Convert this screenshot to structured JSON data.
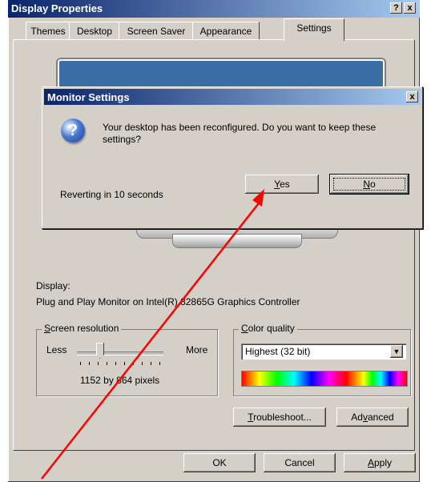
{
  "window": {
    "title": "Display Properties",
    "help_button": "?",
    "close_button": "x"
  },
  "tabs": [
    {
      "label": "Themes"
    },
    {
      "label": "Desktop"
    },
    {
      "label": "Screen Saver"
    },
    {
      "label": "Appearance"
    },
    {
      "label": "Settings"
    }
  ],
  "active_tab": "Settings",
  "dialog": {
    "title": "Monitor Settings",
    "close_button": "x",
    "message": "Your desktop has been reconfigured.  Do you want to keep these settings?",
    "countdown": "Reverting in 10 seconds",
    "yes_label": "Yes",
    "no_label": "No"
  },
  "display": {
    "label": "Display:",
    "value": "Plug and Play Monitor on Intel(R) 82865G Graphics Controller"
  },
  "resolution": {
    "group_label": "Screen resolution",
    "less": "Less",
    "more": "More",
    "value_text": "1152 by 864 pixels"
  },
  "color_quality": {
    "group_label": "Color quality",
    "selected": "Highest (32 bit)"
  },
  "buttons": {
    "troubleshoot": "Troubleshoot...",
    "advanced": "Advanced",
    "ok": "OK",
    "cancel": "Cancel",
    "apply": "Apply"
  },
  "colors": {
    "titlebar_start": "#0a246a",
    "titlebar_end": "#a6caf0",
    "face": "#d4d0c8",
    "annotation_arrow": "#ff0000"
  }
}
